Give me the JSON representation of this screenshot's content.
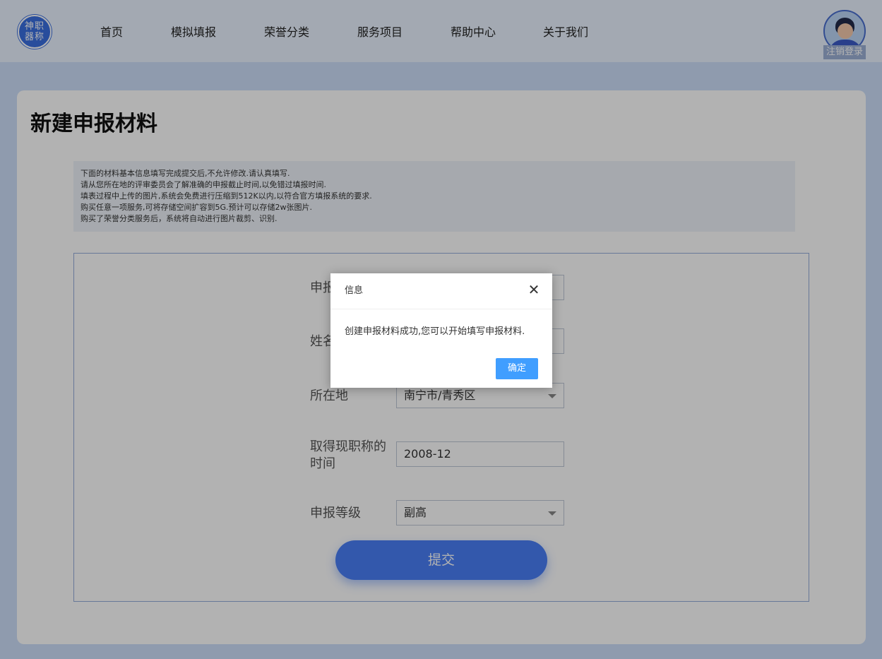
{
  "header": {
    "logo_text": "神职器称",
    "nav": [
      "首页",
      "模拟填报",
      "荣誉分类",
      "服务项目",
      "帮助中心",
      "关于我们"
    ],
    "logout_label": "注销登录"
  },
  "page": {
    "title": "新建申报材料",
    "notice": [
      "下面的材料基本信息填写完成提交后,不允许修改.请认真填写.",
      "请从您所在地的评审委员会了解准确的申报截止时间,以免错过填报时间.",
      "填表过程中上传的图片,系统会免费进行压缩到512K以内,以符合官方填报系统的要求.",
      "购买任意一项服务,可将存储空间扩容到5G.预计可以存储2w张图片.",
      "购买了荣誉分类服务后，系统将自动进行图片裁剪、识别."
    ]
  },
  "form": {
    "fields": [
      {
        "label": "申报",
        "value": ""
      },
      {
        "label": "姓名",
        "value": ""
      },
      {
        "label": "所在地",
        "value": "南宁市/青秀区"
      },
      {
        "label": "取得现职称的时间",
        "value": "2008-12"
      },
      {
        "label": "申报等级",
        "value": "副高"
      }
    ],
    "submit_label": "提交"
  },
  "dialog": {
    "title": "信息",
    "close_icon": "close-icon",
    "message": "创建申报材料成功,您可以开始填写申报材料.",
    "ok_label": "确定"
  },
  "colors": {
    "accent": "#4a7ff6",
    "dialog_button": "#409eff",
    "header_bg": "#eaf3ff",
    "page_bg": "#cddff9"
  }
}
